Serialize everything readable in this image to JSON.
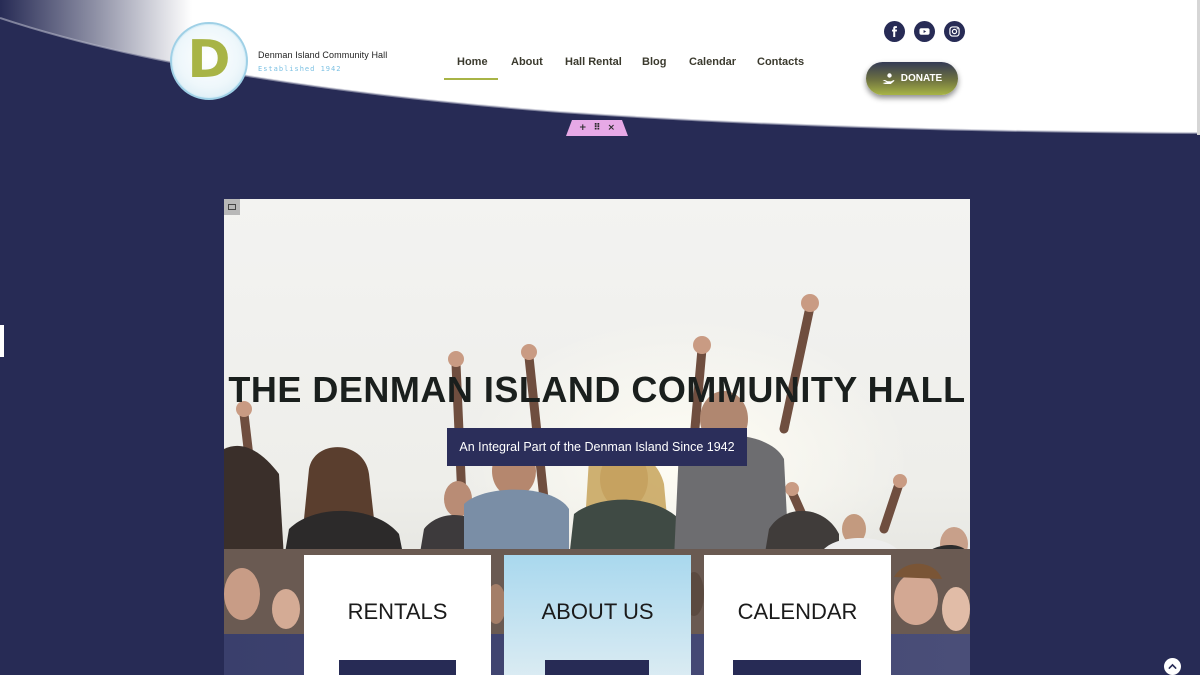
{
  "header": {
    "brand": {
      "logo_letter": "D",
      "name": "Denman Island Community Hall",
      "established": "Established 1942"
    },
    "nav": [
      {
        "label": "Home",
        "active": true
      },
      {
        "label": "About"
      },
      {
        "label": "Hall Rental"
      },
      {
        "label": "Blog"
      },
      {
        "label": "Calendar"
      },
      {
        "label": "Contacts"
      }
    ],
    "social": [
      "facebook-icon",
      "youtube-icon",
      "instagram-icon"
    ],
    "donate": {
      "label": "DONATE",
      "icon": "hand-donate-icon"
    }
  },
  "editor_handle": {
    "add": "+",
    "drag": "⠿",
    "close": "×"
  },
  "hero": {
    "title": "THE DENMAN ISLAND COMMUNITY HALL",
    "subtitle": "An Integral Part of the Denman Island Since 1942"
  },
  "cards": [
    {
      "title": "RENTALS"
    },
    {
      "title": "ABOUT US"
    },
    {
      "title": "CALENDAR"
    }
  ],
  "colors": {
    "navy": "#272b55",
    "olive_accent": "#a8b446",
    "sky": "#a9d8ee"
  }
}
